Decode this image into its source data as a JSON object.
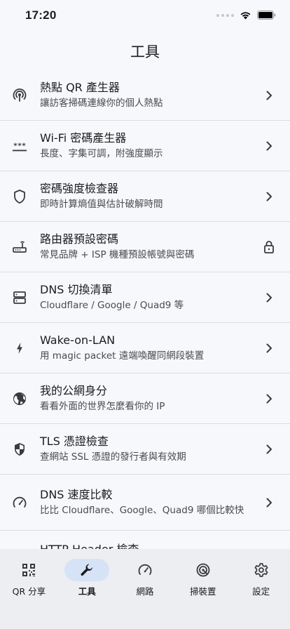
{
  "status": {
    "time": "17:20"
  },
  "header": {
    "title": "工具"
  },
  "tools": [
    {
      "title": "熱點 QR 產生器",
      "subtitle": "讓訪客掃碼連線你的個人熱點",
      "icon": "hotspot-icon",
      "trail": "chevron-right-icon"
    },
    {
      "title": "Wi-Fi 密碼產生器",
      "subtitle": "長度、字集可調，附強度顯示",
      "icon": "password-icon",
      "trail": "chevron-right-icon"
    },
    {
      "title": "密碼強度檢查器",
      "subtitle": "即時計算熵值與估計破解時間",
      "icon": "shield-icon",
      "trail": "chevron-right-icon"
    },
    {
      "title": "路由器預設密碼",
      "subtitle": "常見品牌 + ISP 機種預設帳號與密碼",
      "icon": "router-icon",
      "trail": "lock-icon"
    },
    {
      "title": "DNS 切換清單",
      "subtitle": "Cloudflare / Google / Quad9 等",
      "icon": "dns-icon",
      "trail": "chevron-right-icon"
    },
    {
      "title": "Wake-on-LAN",
      "subtitle": "用 magic packet 遠端喚醒同網段裝置",
      "icon": "bolt-icon",
      "trail": "chevron-right-icon"
    },
    {
      "title": "我的公網身分",
      "subtitle": "看看外面的世界怎麼看你的 IP",
      "icon": "globe-icon",
      "trail": "chevron-right-icon"
    },
    {
      "title": "TLS 憑證檢查",
      "subtitle": "查網站 SSL 憑證的發行者與有效期",
      "icon": "security-shield-icon",
      "trail": "chevron-right-icon"
    },
    {
      "title": "DNS 速度比較",
      "subtitle": "比比 Cloudflare、Google、Quad9 哪個比較快",
      "icon": "speedometer-icon",
      "trail": "chevron-right-icon"
    },
    {
      "title": "HTTP Header 檢查",
      "subtitle": "",
      "icon": "http-icon",
      "trail": "chevron-right-icon"
    }
  ],
  "tabs": [
    {
      "label": "QR 分享",
      "icon": "qr-code-icon",
      "active": false
    },
    {
      "label": "工具",
      "icon": "wrench-icon",
      "active": true
    },
    {
      "label": "網路",
      "icon": "speedometer-icon",
      "active": false
    },
    {
      "label": "掃裝置",
      "icon": "radar-icon",
      "active": false
    },
    {
      "label": "設定",
      "icon": "gear-icon",
      "active": false
    }
  ],
  "colors": {
    "background": "#f7f8fb",
    "tabbar": "#eceef2",
    "active_pill": "#d6e3f7",
    "divider": "#dadde3"
  }
}
